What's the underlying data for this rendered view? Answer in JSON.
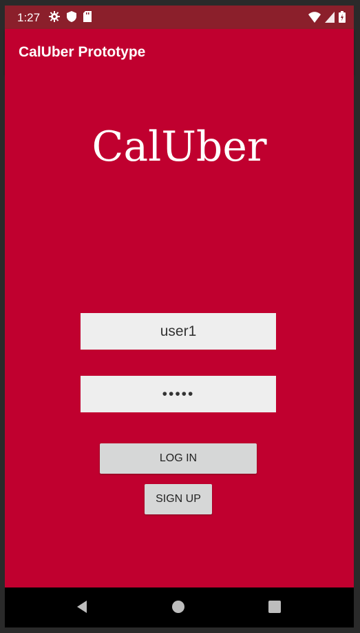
{
  "status_bar": {
    "time": "1:27",
    "left_icons": [
      "gear-icon",
      "shield-icon",
      "sd-card-icon"
    ],
    "right_icons": [
      "wifi-icon",
      "signal-icon",
      "battery-icon"
    ]
  },
  "app_bar": {
    "title": "CalUber Prototype"
  },
  "main": {
    "logo_text": "CalUber",
    "username_value": "user1",
    "password_value": "•••••",
    "login_label": "LOG IN",
    "signup_label": "SIGN UP"
  },
  "nav_bar": {
    "buttons": [
      "back-icon",
      "home-icon",
      "recents-icon"
    ]
  },
  "colors": {
    "primary": "#c0002f",
    "status_bar": "#8b1f2b",
    "input_bg": "#eeeeee",
    "button_bg": "#d6d7d7"
  }
}
